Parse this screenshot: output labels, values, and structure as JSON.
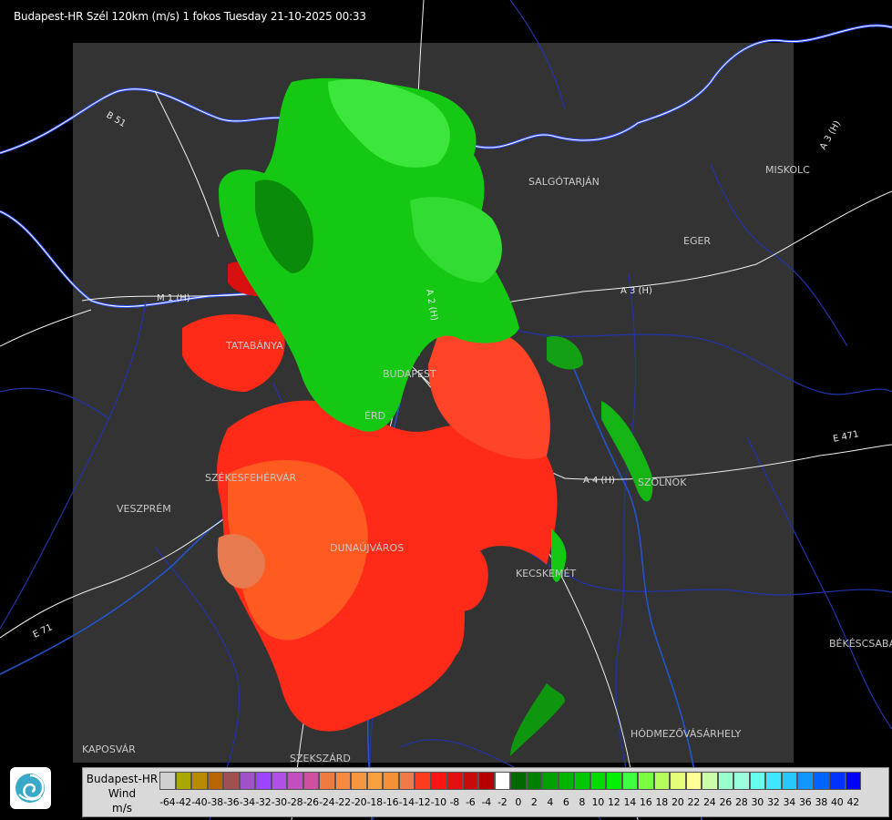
{
  "header": {
    "title": "Budapest-HR Szél 120km (m/s) 1 fokos Tuesday 21-10-2025 00:33"
  },
  "map": {
    "cities": [
      "SALGÓTARJÁN",
      "MISKOLC",
      "EGER",
      "TATABÁNYA",
      "BUDAPEST",
      "ÉRD",
      "SZÉKESFEHÉRVÁR",
      "VESZPRÉM",
      "DUNAÚJVÁROS",
      "SZOLNOK",
      "KECSKEMÉT",
      "BÉKÉSCSABA",
      "HÓDMEZŐVÁSÁRHELY",
      "KAPOSVÁR",
      "SZEKSZÁRD"
    ],
    "roads": [
      "B 51",
      "A 3 (H)",
      "M 1 (H)",
      "A 2 (H)",
      "A 4 (H)",
      "E 471",
      "E 71",
      "A 3 (H)"
    ]
  },
  "legend": {
    "name_lines": [
      "Budapest-HR",
      "Wind",
      "m/s"
    ],
    "ticks": [
      "-64",
      "-42",
      "-40",
      "-38",
      "-36",
      "-34",
      "-32",
      "-30",
      "-28",
      "-26",
      "-24",
      "-22",
      "-20",
      "-18",
      "-16",
      "-14",
      "-12",
      "-10",
      "-8",
      "-6",
      "-4",
      "-2",
      "0",
      "2",
      "4",
      "6",
      "8",
      "10",
      "12",
      "14",
      "16",
      "18",
      "20",
      "22",
      "24",
      "26",
      "28",
      "30",
      "32",
      "34",
      "36",
      "38",
      "40",
      "42"
    ],
    "colors": [
      "#d0d0d0",
      "#a8a800",
      "#b88a00",
      "#b86400",
      "#a05050",
      "#a050c8",
      "#9a46ff",
      "#b050e6",
      "#c050c0",
      "#d050a0",
      "#ee7a40",
      "#f58a40",
      "#f59640",
      "#f8a040",
      "#f5903a",
      "#f07a48",
      "#ff3c1e",
      "#ff1414",
      "#e01010",
      "#c80a0a",
      "#b40000",
      "#ffffff",
      "#006600",
      "#008000",
      "#00a000",
      "#00b400",
      "#00c800",
      "#00dc00",
      "#00f000",
      "#40ff40",
      "#7aff40",
      "#b4ff5a",
      "#e6ff78",
      "#ffff99",
      "#ccffaa",
      "#99ffcc",
      "#99ffdd",
      "#66ffee",
      "#40e6ff",
      "#28c8ff",
      "#1496ff",
      "#0064ff",
      "#0032ff",
      "#0000ff"
    ],
    "icon": "omsz-logo"
  }
}
